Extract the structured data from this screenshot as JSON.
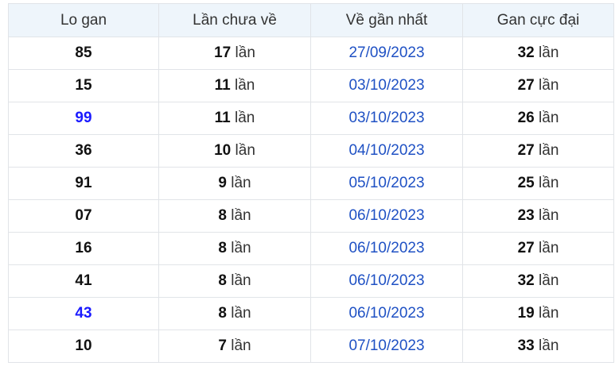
{
  "table": {
    "headers": [
      "Lo gan",
      "Lần chưa về",
      "Về gần nhất",
      "Gan cực đại"
    ],
    "unit": "lần",
    "accent_color": "#1a1aff",
    "date_color": "#1f51c4",
    "rows": [
      {
        "number": "85",
        "highlight": false,
        "missed": "17",
        "last_date": "27/09/2023",
        "max_gap": "32"
      },
      {
        "number": "15",
        "highlight": false,
        "missed": "11",
        "last_date": "03/10/2023",
        "max_gap": "27"
      },
      {
        "number": "99",
        "highlight": true,
        "missed": "11",
        "last_date": "03/10/2023",
        "max_gap": "26"
      },
      {
        "number": "36",
        "highlight": false,
        "missed": "10",
        "last_date": "04/10/2023",
        "max_gap": "27"
      },
      {
        "number": "91",
        "highlight": false,
        "missed": "9",
        "last_date": "05/10/2023",
        "max_gap": "25"
      },
      {
        "number": "07",
        "highlight": false,
        "missed": "8",
        "last_date": "06/10/2023",
        "max_gap": "23"
      },
      {
        "number": "16",
        "highlight": false,
        "missed": "8",
        "last_date": "06/10/2023",
        "max_gap": "27"
      },
      {
        "number": "41",
        "highlight": false,
        "missed": "8",
        "last_date": "06/10/2023",
        "max_gap": "32"
      },
      {
        "number": "43",
        "highlight": true,
        "missed": "8",
        "last_date": "06/10/2023",
        "max_gap": "19"
      },
      {
        "number": "10",
        "highlight": false,
        "missed": "7",
        "last_date": "07/10/2023",
        "max_gap": "33"
      }
    ]
  }
}
